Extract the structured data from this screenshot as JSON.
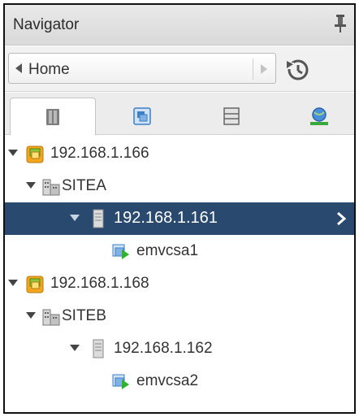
{
  "navigator": {
    "title": "Navigator",
    "back_label": "Home"
  },
  "tabs": [
    {
      "icon": "hosts-clusters-icon",
      "active": true
    },
    {
      "icon": "vms-templates-icon",
      "active": false
    },
    {
      "icon": "storage-icon",
      "active": false
    },
    {
      "icon": "networking-icon",
      "active": false
    }
  ],
  "tree": {
    "vc1": {
      "label": "192.168.1.166",
      "icon": "vcenter-icon",
      "expanded": true
    },
    "dc1": {
      "label": "SITEA",
      "icon": "datacenter-icon",
      "expanded": true
    },
    "host1": {
      "label": "192.168.1.161",
      "icon": "host-icon",
      "expanded": true,
      "selected": true
    },
    "vm1": {
      "label": "emvcsa1",
      "icon": "vm-running-icon"
    },
    "vc2": {
      "label": "192.168.1.168",
      "icon": "vcenter-icon",
      "expanded": true
    },
    "dc2": {
      "label": "SITEB",
      "icon": "datacenter-icon",
      "expanded": true
    },
    "host2": {
      "label": "192.168.1.162",
      "icon": "host-icon",
      "expanded": true
    },
    "vm2": {
      "label": "emvcsa2",
      "icon": "vm-running-icon"
    }
  },
  "colors": {
    "selection": "#29496e",
    "header": "#dedede"
  }
}
